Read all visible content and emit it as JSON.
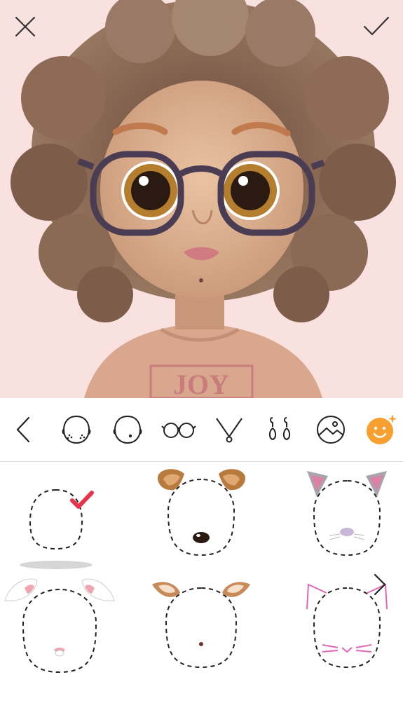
{
  "header": {
    "close_icon": "close-icon",
    "done_icon": "checkmark-icon"
  },
  "preview": {
    "shirt_text": "JOY",
    "background_color": "#f9e1e0"
  },
  "toolbar": {
    "items": [
      {
        "icon": "back-arrow-icon"
      },
      {
        "icon": "face-freckles-icon"
      },
      {
        "icon": "face-mole-icon"
      },
      {
        "icon": "glasses-icon"
      },
      {
        "icon": "necklace-icon"
      },
      {
        "icon": "earrings-icon"
      },
      {
        "icon": "background-icon"
      },
      {
        "icon": "sticker-face-icon",
        "active": true
      }
    ],
    "active_color": "#f7a030"
  },
  "filters": {
    "items": [
      {
        "name": "none",
        "selected": true
      },
      {
        "name": "dog"
      },
      {
        "name": "cat"
      },
      {
        "name": "bunny"
      },
      {
        "name": "deer"
      },
      {
        "name": "cat-outline"
      }
    ],
    "selected_color": "#e8334a"
  }
}
